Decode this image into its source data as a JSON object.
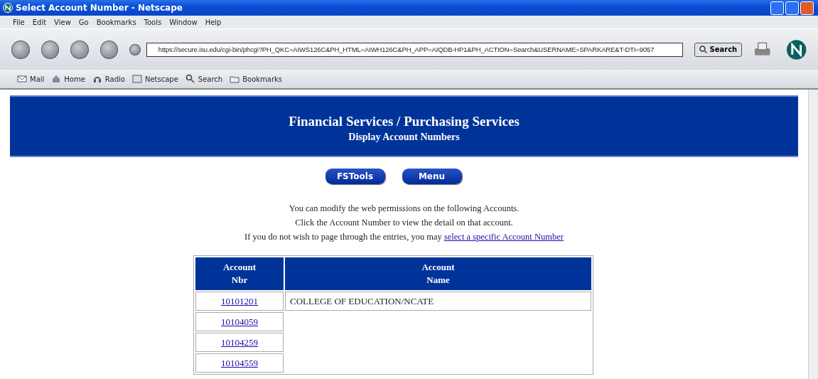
{
  "window": {
    "title": "Select Account Number - Netscape"
  },
  "menu": [
    "File",
    "Edit",
    "View",
    "Go",
    "Bookmarks",
    "Tools",
    "Window",
    "Help"
  ],
  "address": {
    "value": "https://secure.isu.edu/cgi-bin/phcgi?PH_QKC=AIWS126C&PH_HTML=AIWH126C&PH_APP=AIQDB-HP1&PH_ACTION=Search&USERNAME=SPARKARE&T-DTI=9057"
  },
  "search_button": "Search",
  "personal_toolbar": [
    {
      "kind": "mail",
      "label": "Mail"
    },
    {
      "kind": "home",
      "label": "Home"
    },
    {
      "kind": "radio",
      "label": "Radio"
    },
    {
      "kind": "my",
      "label": "Netscape"
    },
    {
      "kind": "search",
      "label": "Search"
    },
    {
      "kind": "folder",
      "label": "Bookmarks"
    }
  ],
  "banner": {
    "title": "Financial Services / Purchasing Services",
    "subtitle": "Display Account Numbers"
  },
  "nav_buttons": [
    "FSTools",
    "Menu"
  ],
  "intro": [
    "You can modify the web permissions on the following Accounts.",
    "Click the Account Number to view the detail on that account."
  ],
  "intro_last": {
    "text": "If you do not wish to page through the entries, you may",
    "link": "select a specific Account Number"
  },
  "table": {
    "columns": [
      [
        "Account",
        "Nbr"
      ],
      [
        "Account",
        "Name"
      ]
    ],
    "rows": [
      {
        "number": "10101201",
        "name": "COLLEGE OF EDUCATION/NCATE"
      },
      {
        "number": "10104059"
      },
      {
        "number": "10104259"
      },
      {
        "number": "10104559"
      }
    ]
  }
}
